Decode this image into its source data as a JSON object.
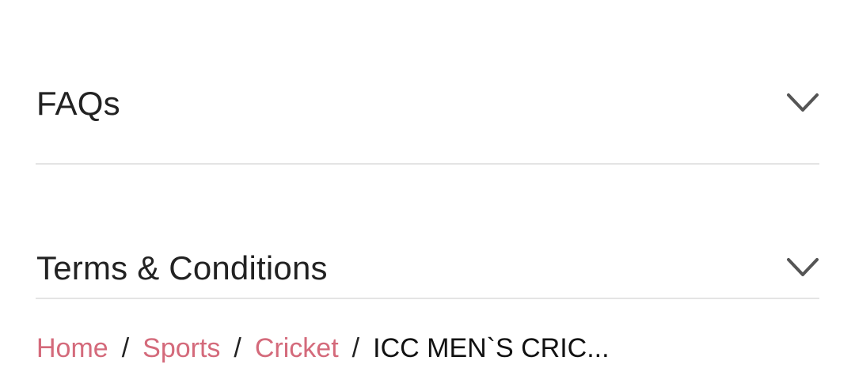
{
  "accordion": {
    "items": [
      {
        "label": "FAQs",
        "icon": "chevron-down-icon"
      },
      {
        "label": "Terms & Conditions",
        "icon": "chevron-down-icon"
      }
    ]
  },
  "breadcrumb": {
    "items": [
      {
        "label": "Home"
      },
      {
        "label": "Sports"
      },
      {
        "label": "Cricket"
      }
    ],
    "separator": "/",
    "current": "ICC MEN`S CRIC..."
  },
  "colors": {
    "link": "#d46a7b",
    "divider": "#e4e4e4",
    "text": "#222222"
  }
}
